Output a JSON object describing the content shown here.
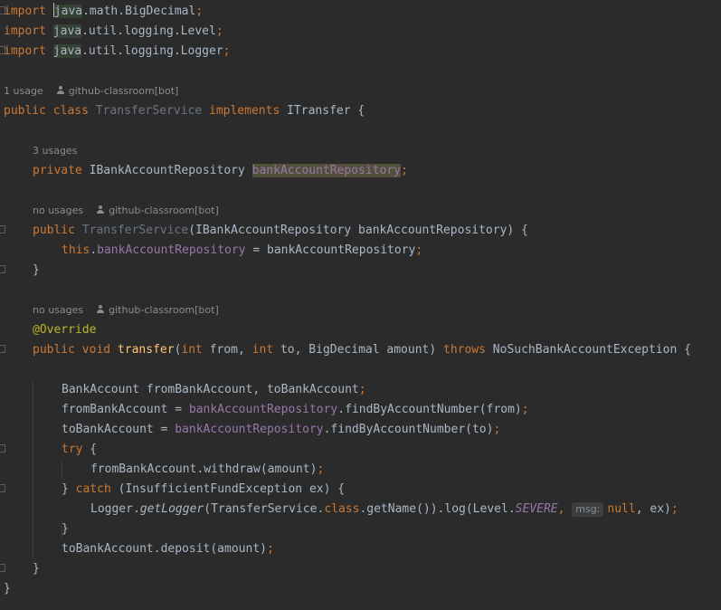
{
  "lines": {
    "imp1_kw": "import",
    "imp1_pkg": "java",
    "imp1_rest": ".math.BigDecimal",
    "semi": ";",
    "imp2_kw": "import",
    "imp2_pkg": "java",
    "imp2_rest": ".util.logging.Level",
    "imp3_kw": "import",
    "imp3_pkg": "java",
    "imp3_rest": ".util.logging.Logger",
    "hint_class_usage": "1 usage",
    "hint_author": "github-classroom[bot]",
    "class_public": "public",
    "class_kw": "class",
    "class_name": "TransferService",
    "implements_kw": "implements",
    "interface_name": "ITransfer",
    "open_brace": "{",
    "hint_field_usages": "3 usages",
    "field_private": "private",
    "field_type": "IBankAccountRepository",
    "field_name": "bankAccountRepository",
    "hint_no_usages": "no usages",
    "ctor_public": "public",
    "ctor_name": "TransferService",
    "ctor_params": "(IBankAccountRepository bankAccountRepository) {",
    "this_kw": "this",
    "assign_rest": " = bankAccountRepository",
    "close_brace": "}",
    "override_ann": "@Override",
    "m_public": "public",
    "m_void": "void",
    "m_name": "transfer",
    "m_open": "(",
    "m_int": "int",
    "m_from": " from, ",
    "m_int2": "int",
    "m_to": " to, BigDecimal amount) ",
    "m_throws": "throws",
    "m_exc": " NoSuchBankAccountException {",
    "decl": "BankAccount fromBankAccount, toBankAccount",
    "from_assign": "fromBankAccount = ",
    "repo": "bankAccountRepository",
    "find_from": ".findByAccountNumber(from)",
    "to_assign": "toBankAccount = ",
    "find_to": ".findByAccountNumber(to)",
    "try_kw": "try",
    "try_brace": " {",
    "withdraw": "fromBankAccount.withdraw(amount)",
    "catch_close": "} ",
    "catch_kw": "catch",
    "catch_rest": " (InsufficientFundException ex) {",
    "logger": "Logger.",
    "get_logger": "getLogger",
    "ts_open": "(TransferService.",
    "class_lit": "class",
    "get_name_log": ".getName()).log(Level.",
    "severe": "SEVERE",
    "comma_sp": ", ",
    "msg_hint": "msg:",
    "null_kw": "null",
    "ex_close": ", ex)",
    "deposit": "toBankAccount.deposit(amount)"
  },
  "colors": {
    "background": "#2b2b2b",
    "keyword": "#cc7832",
    "field": "#9876aa",
    "method": "#ffc66d",
    "annotation": "#bbb529",
    "text": "#a9b7c6"
  },
  "icons": [
    "person-icon",
    "fold-marker-icon",
    "caret-cursor"
  ]
}
